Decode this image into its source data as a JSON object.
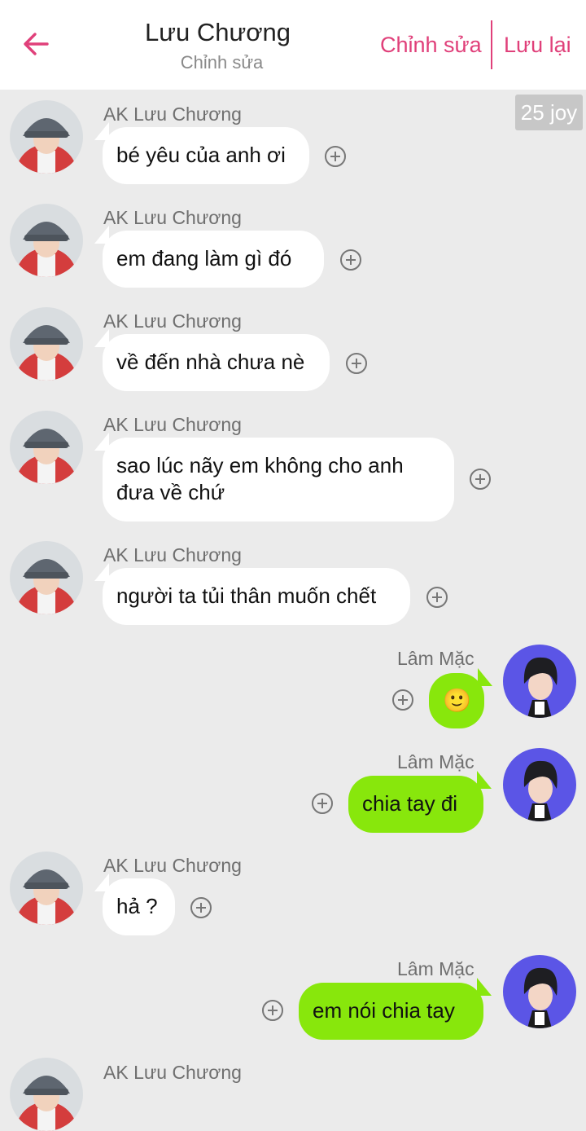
{
  "header": {
    "title": "Lưu Chương",
    "subtitle": "Chỉnh sửa",
    "edit_label": "Chỉnh sửa",
    "save_label": "Lưu lại",
    "accent_color": "#e0407a"
  },
  "badge": {
    "text": "25 joy"
  },
  "messages": [
    {
      "side": "left",
      "sender": "AK Lưu Chương",
      "text": "bé yêu của anh ơi"
    },
    {
      "side": "left",
      "sender": "AK Lưu Chương",
      "text": "em đang làm gì đó"
    },
    {
      "side": "left",
      "sender": "AK Lưu Chương",
      "text": "về đến nhà chưa nè"
    },
    {
      "side": "left",
      "sender": "AK Lưu Chương",
      "text": "sao lúc nãy em không cho anh đưa về chứ"
    },
    {
      "side": "left",
      "sender": "AK Lưu Chương",
      "text": "người ta tủi thân muốn chết"
    },
    {
      "side": "right",
      "sender": "Lâm Mặc",
      "text": "🙂"
    },
    {
      "side": "right",
      "sender": "Lâm Mặc",
      "text": "chia tay đi"
    },
    {
      "side": "left",
      "sender": "AK Lưu Chương",
      "text": "hả ?"
    },
    {
      "side": "right",
      "sender": "Lâm Mặc",
      "text": "em nói chia tay"
    },
    {
      "side": "left",
      "sender": "AK Lưu Chương",
      "text": ""
    }
  ],
  "colors": {
    "background": "#ebebeb",
    "left_bubble": "#ffffff",
    "right_bubble": "#88e70c",
    "right_avatar_bg": "#5b55e6"
  }
}
